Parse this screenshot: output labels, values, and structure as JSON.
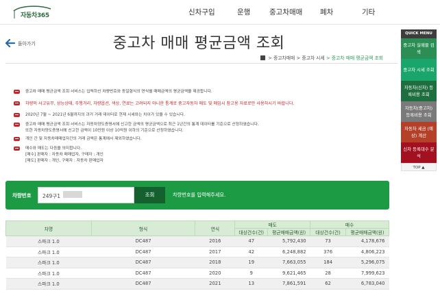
{
  "header": {
    "logo_text": "자동차365",
    "nav": [
      "신차구입",
      "운행",
      "중고차매매",
      "폐차",
      "기타"
    ]
  },
  "back_label": "돌아가기",
  "page_title": "중고차 매매 평균금액 조회",
  "breadcrumb": {
    "items": [
      "> 중고차매매",
      "> 중고차 시세"
    ],
    "current": "> 중고차 매매 평균금액 조회"
  },
  "notices": [
    {
      "lines": [
        "중고차 매매 평균금액 조회 서비스는 입력하신 차량번호와 동일형식의 연식별 매매금액의 평균금액을 제공합니다."
      ],
      "red": false
    },
    {
      "lines": [
        "차량의 사고유무, 성능상태, 주행거리, 차량옵션, 색상, 연료는 고려되지 아니한 통계로 중고자동차 매도 및 매입시 참고용 자료로만 사용하시기 바랍니다."
      ],
      "red": true
    },
    {
      "lines": [
        "2020년 7월 ~ 2021년 6월까지의 과거 거래 데이터로 현재 시세와는 차이가 있을 수 있습니다."
      ],
      "red": false
    },
    {
      "lines": [
        "중고차 매매 평균금액 조회 서비스는 자동차양도증명서에 신고한 금액의 평균금액으로 최근 1년간의 통계 데이터를 기준으로 산정하였습니다.",
        "또한 자동차양도증명서에 신고한 금액이 10만원 이상 10억원 이하의 기준으로 산정하였습니다."
      ],
      "red": false
    },
    {
      "lines": [
        "개인 간 및 자동차매매업자간의 거래 금액은 통계에서 제외하였습니다."
      ],
      "red": false
    },
    {
      "lines": [
        "매수와 매도는 다음을 의미합니다.",
        "[매수] 판매자 : 자동차 매매업자, 구매자 : 개인",
        "[매도] 판매자 : 개인, 구매자 : 자동차 판매업자"
      ],
      "red": false
    }
  ],
  "search": {
    "label": "차량번호",
    "value": "249구1",
    "button": "조회",
    "hint": "차량번호를 입력해주세요."
  },
  "table": {
    "headers": {
      "model": "차명",
      "type": "형식",
      "year": "연식",
      "sell": "매도",
      "buy": "매수",
      "count": "대상건수(건)",
      "avg": "평균매매금액(원)"
    },
    "rows": [
      {
        "model": "스파크 1.0",
        "type": "DC487",
        "year": "2016",
        "sell_count": "47",
        "sell_avg": "5,792,430",
        "buy_count": "73",
        "buy_avg": "4,178,676"
      },
      {
        "model": "스파크 1.0",
        "type": "DC487",
        "year": "2017",
        "sell_count": "42",
        "sell_avg": "6,248,882",
        "buy_count": "376",
        "buy_avg": "4,806,223"
      },
      {
        "model": "스파크 1.0",
        "type": "DC487",
        "year": "2018",
        "sell_count": "19",
        "sell_avg": "7,663,055",
        "buy_count": "184",
        "buy_avg": "5,296,075"
      },
      {
        "model": "스파크 1.0",
        "type": "DC487",
        "year": "2020",
        "sell_count": "9",
        "sell_avg": "9,621,465",
        "buy_count": "28",
        "buy_avg": "7,999,623"
      },
      {
        "model": "스파크 1.0",
        "type": "DC487",
        "year": "2021",
        "sell_count": "13",
        "sell_avg": "7,861,591",
        "buy_count": "62",
        "buy_avg": "6,783,040"
      }
    ]
  },
  "quick_menu": {
    "title": "QUICK MENU",
    "items": [
      {
        "label": "중고차 실매물 검색",
        "color": "#2b8f55"
      },
      {
        "label": "중고차 시세 조회",
        "color": "#1aa56a"
      },
      {
        "label": "자동차(신차) 등록비용 조회",
        "color": "#1f6e3f"
      },
      {
        "label": "자동차(중고차) 등록비용 조회",
        "color": "#7a7a7a"
      },
      {
        "label": "자동차 세금 (예상) 계산",
        "color": "#b5402a"
      },
      {
        "label": "신차 등록대수 분석",
        "color": "#a3101f"
      }
    ],
    "top": "TOP ▲"
  }
}
